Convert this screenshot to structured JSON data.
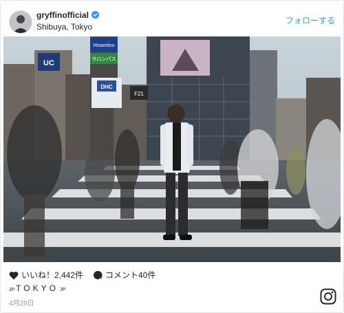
{
  "header": {
    "username": "gryffinofficial",
    "location": "Shibuya, Tokyo",
    "follow_label": "フォローする"
  },
  "photo": {
    "signs": {
      "hisamitsu": "Hisamitsu",
      "salonpas": "サロンパス",
      "uc": "UC",
      "dhc": "DHC",
      "f21": "F21"
    }
  },
  "actions": {
    "likes_text": "いいね！2,442件",
    "comments_text": "コメント40件"
  },
  "caption": {
    "prefix": "JP",
    "main": "TOKYO",
    "suffix": "JP"
  },
  "date": "4月29日",
  "icons": {
    "verified": "verified-badge-icon",
    "heart": "heart-icon",
    "comment": "comment-bubble-icon",
    "tag": "user-tag-icon",
    "instagram": "instagram-logo-icon"
  },
  "colors": {
    "accent": "#3897f0",
    "text": "#262626",
    "muted": "#999999"
  }
}
